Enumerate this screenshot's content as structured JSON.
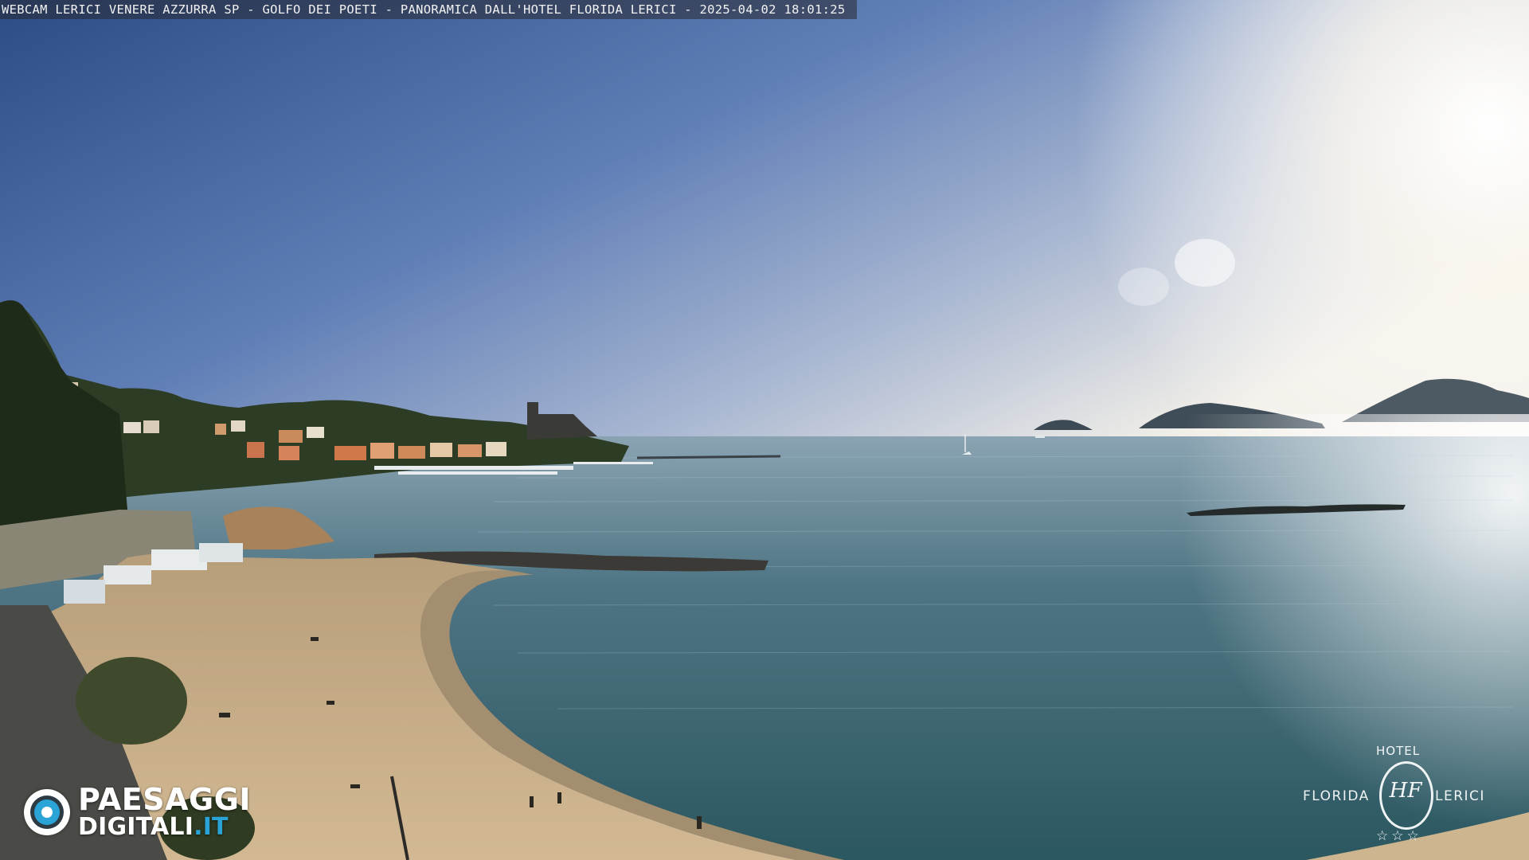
{
  "overlay": {
    "caption": "WEBCAM LERICI VENERE AZZURRA SP - GOLFO DEI POETI - PANORAMICA DALL'HOTEL FLORIDA LERICI - 2025-04-02 18:01:25"
  },
  "watermark_left": {
    "line1": "PAESAGGI",
    "line2_main": "DIGITALI",
    "line2_tld": ".IT",
    "accent_color": "#2aa3d6"
  },
  "watermark_right": {
    "top": "HOTEL",
    "left": "FLORIDA",
    "right": "LERICI",
    "monogram": "HF",
    "stars": "☆☆☆"
  },
  "scene": {
    "sky_colors": [
      "#2f4f8a",
      "#6f8cbd",
      "#c9cfdc",
      "#f4f1ea"
    ],
    "sea_colors": [
      "#6f8ea3",
      "#3e6a78",
      "#2d5a63"
    ],
    "sand_color": "#c9b08a",
    "hill_color": "#2a3a22"
  }
}
